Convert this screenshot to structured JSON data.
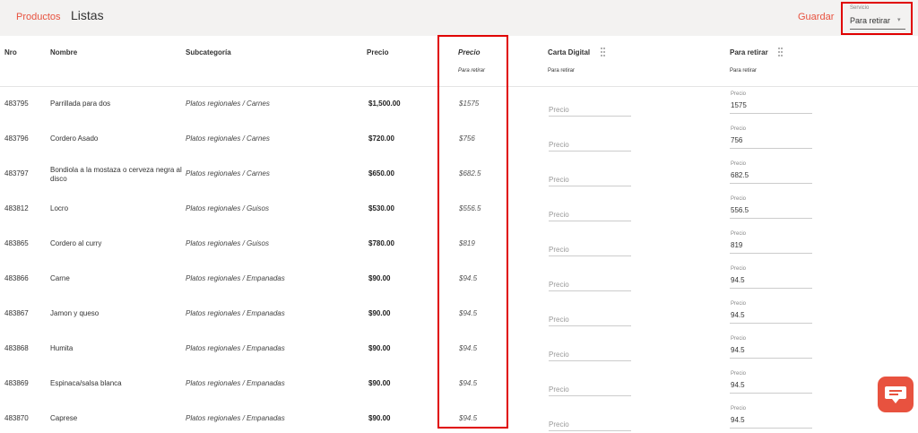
{
  "nav": {
    "productos": "Productos",
    "listas": "Listas"
  },
  "toolbar": {
    "guardar": "Guardar"
  },
  "servicio": {
    "label": "Servicio",
    "value": "Para retirar",
    "caret": "▾"
  },
  "headers": {
    "nro": "Nro",
    "nombre": "Nombre",
    "subcategoria": "Subcategoría",
    "precio": "Precio",
    "precio_retirar": "Precio",
    "precio_retirar_sub": "Para retirar",
    "carta_digital": "Carta Digital",
    "carta_digital_sub": "Para retirar",
    "para_retirar": "Para retirar",
    "para_retirar_sub": "Para retirar"
  },
  "input_label": "Precio",
  "rows": [
    {
      "nro": "483795",
      "nombre": "Parrillada para dos",
      "subcategoria": "Platos regionales / Carnes",
      "precio": "$1,500.00",
      "precio_retirar": "$1575",
      "para_retirar": "1575"
    },
    {
      "nro": "483796",
      "nombre": "Cordero Asado",
      "subcategoria": "Platos regionales / Carnes",
      "precio": "$720.00",
      "precio_retirar": "$756",
      "para_retirar": "756"
    },
    {
      "nro": "483797",
      "nombre": "Bondiola a la mostaza o cerveza negra al disco",
      "subcategoria": "Platos regionales / Carnes",
      "precio": "$650.00",
      "precio_retirar": "$682.5",
      "para_retirar": "682.5"
    },
    {
      "nro": "483812",
      "nombre": "Locro",
      "subcategoria": "Platos regionales / Guisos",
      "precio": "$530.00",
      "precio_retirar": "$556.5",
      "para_retirar": "556.5"
    },
    {
      "nro": "483865",
      "nombre": "Cordero al curry",
      "subcategoria": "Platos regionales / Guisos",
      "precio": "$780.00",
      "precio_retirar": "$819",
      "para_retirar": "819"
    },
    {
      "nro": "483866",
      "nombre": "Carne",
      "subcategoria": "Platos regionales / Empanadas",
      "precio": "$90.00",
      "precio_retirar": "$94.5",
      "para_retirar": "94.5"
    },
    {
      "nro": "483867",
      "nombre": "Jamon y queso",
      "subcategoria": "Platos regionales / Empanadas",
      "precio": "$90.00",
      "precio_retirar": "$94.5",
      "para_retirar": "94.5"
    },
    {
      "nro": "483868",
      "nombre": "Humita",
      "subcategoria": "Platos regionales / Empanadas",
      "precio": "$90.00",
      "precio_retirar": "$94.5",
      "para_retirar": "94.5"
    },
    {
      "nro": "483869",
      "nombre": "Espinaca/salsa blanca",
      "subcategoria": "Platos regionales / Empanadas",
      "precio": "$90.00",
      "precio_retirar": "$94.5",
      "para_retirar": "94.5"
    },
    {
      "nro": "483870",
      "nombre": "Caprese",
      "subcategoria": "Platos regionales / Empanadas",
      "precio": "$90.00",
      "precio_retirar": "$94.5",
      "para_retirar": "94.5"
    }
  ],
  "icons": {
    "column_menu": "dots-vertical-icon",
    "chat": "chat-icon"
  },
  "colors": {
    "accent": "#e8523f",
    "highlight": "#e00000"
  }
}
